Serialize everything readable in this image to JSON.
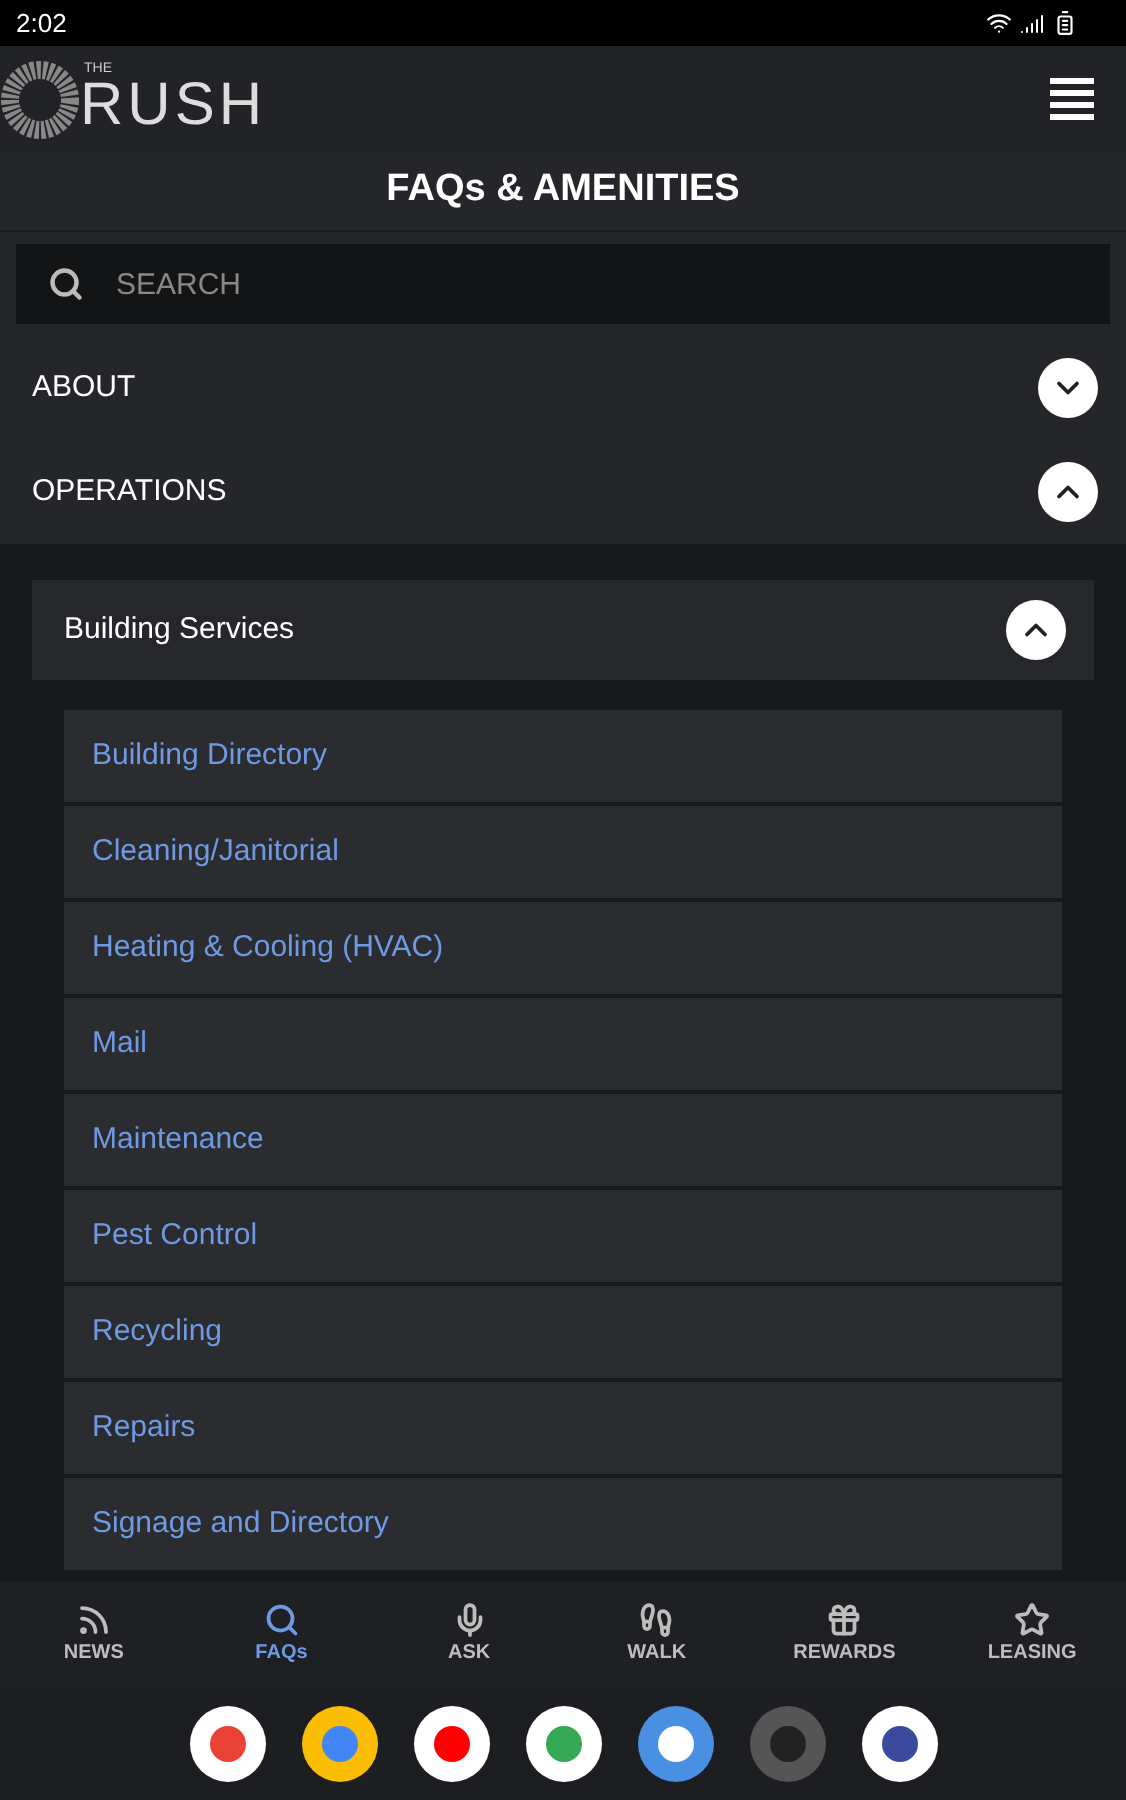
{
  "status_bar": {
    "time": "2:02"
  },
  "header": {
    "logo_small": "THE",
    "logo_text": "RUSH"
  },
  "title": "FAQs & AMENITIES",
  "search": {
    "placeholder": "SEARCH"
  },
  "sections": [
    {
      "label": "ABOUT",
      "expanded": false
    },
    {
      "label": "OPERATIONS",
      "expanded": true,
      "group": {
        "label": "Building Services",
        "expanded": true,
        "items": [
          "Building Directory",
          "Cleaning/Janitorial",
          "Heating & Cooling (HVAC)",
          "Mail",
          "Maintenance",
          "Pest Control",
          "Recycling",
          "Repairs",
          "Signage and Directory"
        ]
      }
    }
  ],
  "bottom_nav": [
    {
      "label": "NEWS",
      "selected": false
    },
    {
      "label": "FAQs",
      "selected": true
    },
    {
      "label": "ASK",
      "selected": false
    },
    {
      "label": "WALK",
      "selected": false
    },
    {
      "label": "REWARDS",
      "selected": false
    },
    {
      "label": "LEASING",
      "selected": false
    }
  ]
}
